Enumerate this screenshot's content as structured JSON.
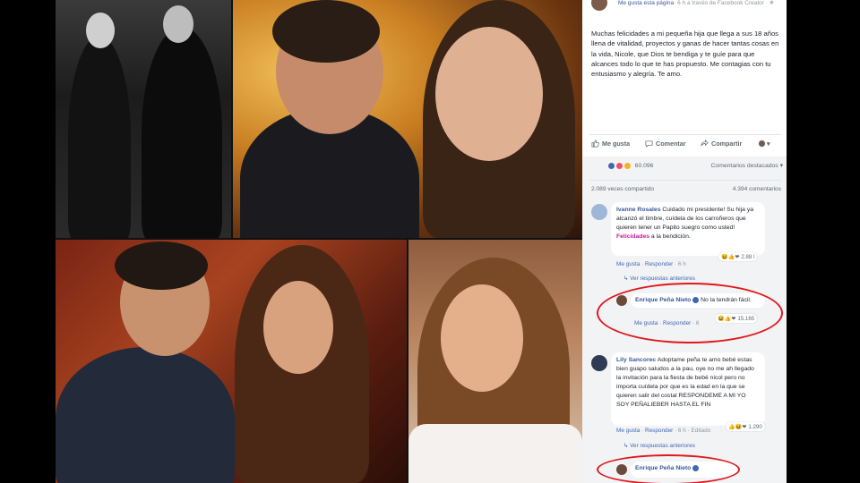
{
  "post": {
    "header_page": "Me gusta esta página",
    "header_location": "· 6 h a través de Facebook Creator · ",
    "text": "Muchas felicidades a mi pequeña hija que llega a sus 18 años llena de vitalidad, proyectos y ganas de hacer tantas cosas en la vida, Nicole, que Dios te bendiga y te guíe para que alcances todo lo que te has propuesto. Me contagias con tu entusiasmo y alegría. Te amo."
  },
  "actions": {
    "like": "Me gusta",
    "comment": "Comentar",
    "share": "Compartir"
  },
  "stats": {
    "reactions_count": "60.096",
    "filter": "Comentarios destacados ▾",
    "shares": "2.089 veces compartido",
    "comments": "4.394 comentarios"
  },
  "comments": [
    {
      "name": "Ivanne Rosales",
      "text_before": "Cuidado mi presidente! Su hija ya alcanzó el timbre, cuídela de los carroñeros que quieren tener un Papito suegro como usted! ",
      "highlight": "Felicidades",
      "text_after": " a la bendición.",
      "like": "Me gusta",
      "reply": "Responder",
      "time": "· 6 h",
      "reactions": "2.88 l",
      "see_replies": "↳ Ver respuestas anteriores"
    },
    {
      "name": "Enrique Peña Nieto",
      "text": " No la tendrán fácil.",
      "like": "Me gusta",
      "reply": "Responder",
      "time": "· 6",
      "reactions": "15.165"
    },
    {
      "name": "Lily Sancorec",
      "text": " Adoptame peña te amo bebé estas bien guapo saludos a la pau, oye no me ah llegado la invitación para la fiesta de bebé nicol pero no importa cuídela por que es la edad en la que se quieren salir del costal RESPONDEME A MI YO SOY PEÑALIEBER HASTA EL FIN",
      "like": "Me gusta",
      "reply": "Responder",
      "time": "· 6 h · Editado",
      "reactions": "1.290",
      "see_replies": "↳ Ver respuestas anteriores"
    },
    {
      "name": "Enrique Peña Nieto"
    }
  ],
  "colors": {
    "link": "#365899",
    "highlight": "#c4189c",
    "annotation": "#e0181b",
    "comment_bg": "#f2f3f5"
  }
}
